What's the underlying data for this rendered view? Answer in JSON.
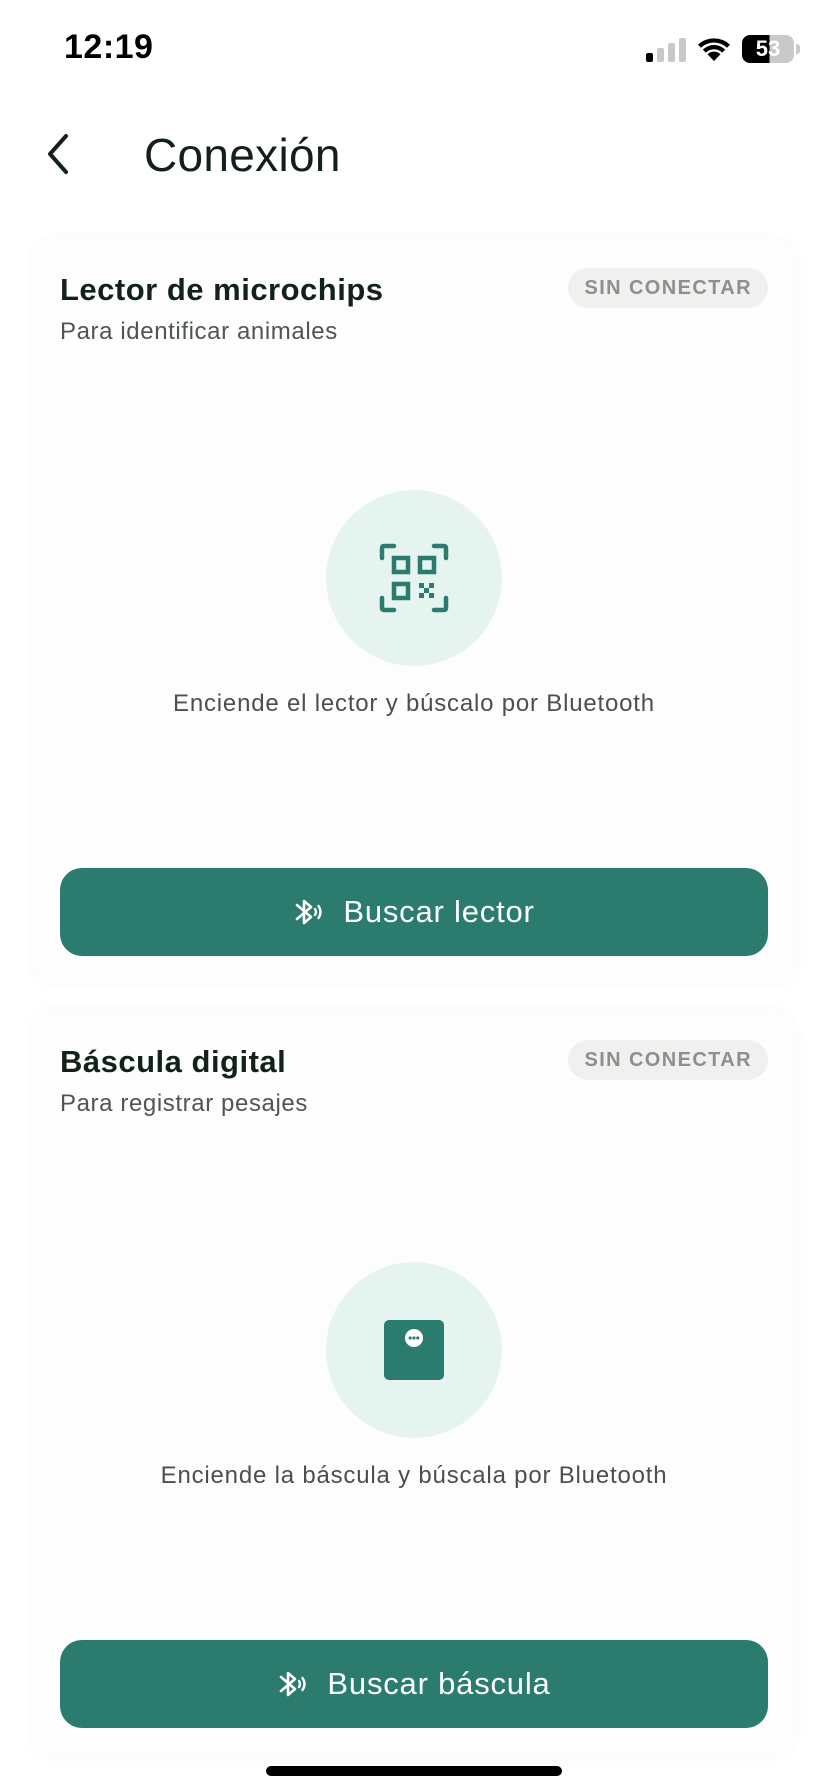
{
  "status_bar": {
    "time": "12:19",
    "battery": "53",
    "icons": [
      "signal-icon",
      "wifi-icon",
      "battery-icon"
    ]
  },
  "header": {
    "title": "Conexión",
    "back_icon": "chevron-left-icon"
  },
  "devices": [
    {
      "title": "Lector de microchips",
      "subtitle": "Para identificar animales",
      "status": "SIN CONECTAR",
      "icon": "qr-scan-icon",
      "hint": "Enciende el lector y búscalo por Bluetooth",
      "button_label": "Buscar lector",
      "button_icon": "bluetooth-searching-icon"
    },
    {
      "title": "Báscula digital",
      "subtitle": "Para registrar pesajes",
      "status": "SIN CONECTAR",
      "icon": "scale-icon",
      "hint": "Enciende la báscula y búscala por Bluetooth",
      "button_label": "Buscar báscula",
      "button_icon": "bluetooth-searching-icon"
    }
  ],
  "colors": {
    "primary": "#2b7c6f",
    "icon_circle_bg": "#e6f4f0",
    "badge_bg": "#f0f0ef",
    "badge_text": "#8c908d",
    "title_text": "#132218"
  }
}
